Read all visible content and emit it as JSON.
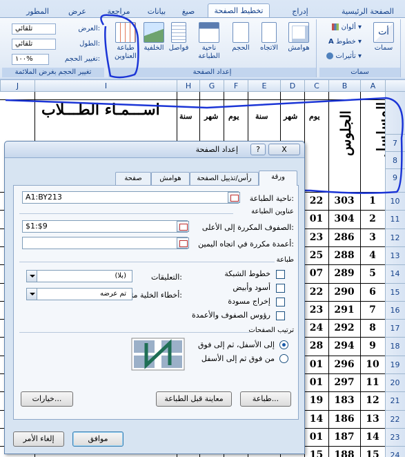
{
  "ribbon": {
    "tabs": [
      "الصفحة الرئيسية",
      "إدراج",
      "تخطيط الصفحة",
      "صيغ",
      "بيانات",
      "مراجعة",
      "عرض",
      "المطور"
    ],
    "active_tab": "تخطيط الصفحة",
    "themes": {
      "label": "سمات",
      "colors": "ألوان",
      "fonts": "خطوط",
      "effects": "تأثيرات",
      "themes_btn": "سمات"
    },
    "page_setup": {
      "label": "إعداد الصفحة",
      "margins": "هوامش",
      "orientation": "الاتجاه",
      "size": "الحجم",
      "print_area": "ناحية الطباعة",
      "breaks": "فواصل",
      "background": "الخلفية",
      "print_titles": "طباعة العناوين"
    },
    "scale": {
      "label": "تغيير الحجم بغرض الملائمة",
      "width_label": "العرض:",
      "width_value": "تلقائي",
      "height_label": "الطول:",
      "height_value": "تلقائي",
      "scale_label": "تغيير الحجم:",
      "scale_value": "١٠٠%"
    }
  },
  "sheet": {
    "columns": [
      "A",
      "B",
      "C",
      "D",
      "E",
      "F",
      "G",
      "H",
      "I",
      "J"
    ],
    "header_texts": {
      "serial": "المسلسل",
      "seat": "الجلوس",
      "names": "اســـمـاء الطـــلاب",
      "day": "يوم",
      "month": "شهر",
      "year": "سنة"
    },
    "rows": [
      {
        "n": "7"
      },
      {
        "n": "8"
      },
      {
        "n": "9"
      },
      {
        "n": "10",
        "a": "1",
        "b": "303",
        "c": "22"
      },
      {
        "n": "11",
        "a": "2",
        "b": "304",
        "c": "01"
      },
      {
        "n": "12",
        "a": "3",
        "b": "286",
        "c": "23"
      },
      {
        "n": "13",
        "a": "4",
        "b": "288",
        "c": "25"
      },
      {
        "n": "14",
        "a": "5",
        "b": "289",
        "c": "07"
      },
      {
        "n": "15",
        "a": "6",
        "b": "290",
        "c": "22"
      },
      {
        "n": "16",
        "a": "7",
        "b": "291",
        "c": "23"
      },
      {
        "n": "17",
        "a": "8",
        "b": "292",
        "c": "24"
      },
      {
        "n": "18",
        "a": "9",
        "b": "294",
        "c": "28"
      },
      {
        "n": "19",
        "a": "10",
        "b": "296",
        "c": "01"
      },
      {
        "n": "20",
        "a": "11",
        "b": "297",
        "c": "01"
      },
      {
        "n": "21",
        "a": "12",
        "b": "183",
        "c": "19"
      },
      {
        "n": "22",
        "a": "13",
        "b": "186",
        "c": "14"
      },
      {
        "n": "23",
        "a": "14",
        "b": "187",
        "c": "01"
      },
      {
        "n": "24",
        "a": "15",
        "b": "188",
        "c": "15"
      }
    ]
  },
  "dialog": {
    "title": "إعداد الصفحة",
    "help": "?",
    "close": "X",
    "tabs": [
      "ورقة",
      "رأس/تذييل الصفحة",
      "هوامش",
      "صفحة"
    ],
    "active_tab": "ورقة",
    "print_area_label": "ناحية الطباعة:",
    "print_area_value": "A1:BY213",
    "print_titles_section": "عناوين الطباعة",
    "rows_repeat_label": "الصفوف المكررة إلى الأعلى:",
    "rows_repeat_value": "$1:$9",
    "cols_repeat_label": "أعمدة مكررة في اتجاه اليمين:",
    "cols_repeat_value": "",
    "print_section": "طباعة",
    "gridlines": "خطوط الشبكة",
    "black_white": "أسود وأبيض",
    "draft": "إخراج مسودة",
    "headings": "رؤوس الصفوف والأعمدة",
    "comments_label": "التعليقات:",
    "comments_value": "(بلا)",
    "errors_label": "أخطاء الخلية مثل:",
    "errors_value": "تم عرضه",
    "order_section": "ترتيب الصفحات",
    "down_then_over": "إلى الأسفل، ثم إلى فوق",
    "over_then_down": "من فوق ثم إلى الأسفل",
    "print_btn": "طباعة...",
    "preview_btn": "معاينة قبل الطباعة",
    "options_btn": "خيارات...",
    "ok_btn": "موافق",
    "cancel_btn": "إلغاء الأمر"
  }
}
